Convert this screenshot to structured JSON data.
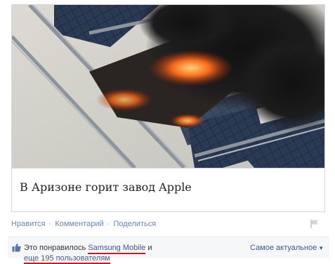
{
  "post": {
    "image_description_icon": "burning-factory-roof-photo",
    "caption": "В Аризоне горит завод Apple"
  },
  "actions": {
    "like": "Нравится",
    "comment": "Комментарий",
    "share": "Поделиться",
    "separator": "·"
  },
  "likes": {
    "prefix": "Это понравилось",
    "brand": "Samsung Mobile",
    "suffix": "и",
    "more": "еще 195 пользователям",
    "sort_label": "Самое актуальное"
  },
  "colors": {
    "link": "#6d84b4",
    "brand_link": "#3b5998",
    "underline_mark": "#d01a1a"
  }
}
